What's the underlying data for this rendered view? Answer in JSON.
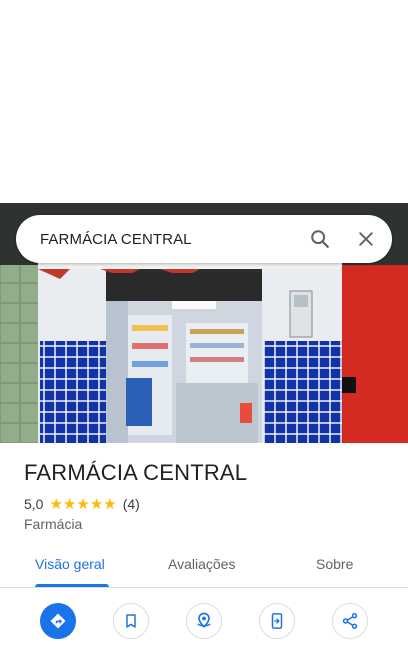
{
  "search": {
    "query": "FARMÁCIA CENTRAL"
  },
  "place": {
    "title": "FARMÁCIA CENTRAL",
    "rating": "5,0",
    "stars": 5,
    "reviews": "(4)",
    "category": "Farmácia"
  },
  "tabs": [
    {
      "label": "Visão geral",
      "active": true
    },
    {
      "label": "Avaliações",
      "active": false
    },
    {
      "label": "Sobre",
      "active": false
    }
  ],
  "actions": [
    {
      "icon": "directions-icon"
    },
    {
      "icon": "bookmark-icon"
    },
    {
      "icon": "nearby-icon"
    },
    {
      "icon": "send-to-phone-icon"
    },
    {
      "icon": "share-icon"
    }
  ],
  "colors": {
    "accent": "#1a73e8",
    "star": "#fbbc04",
    "tile_blue": "#1233a6",
    "wall_red": "#d32a22"
  }
}
